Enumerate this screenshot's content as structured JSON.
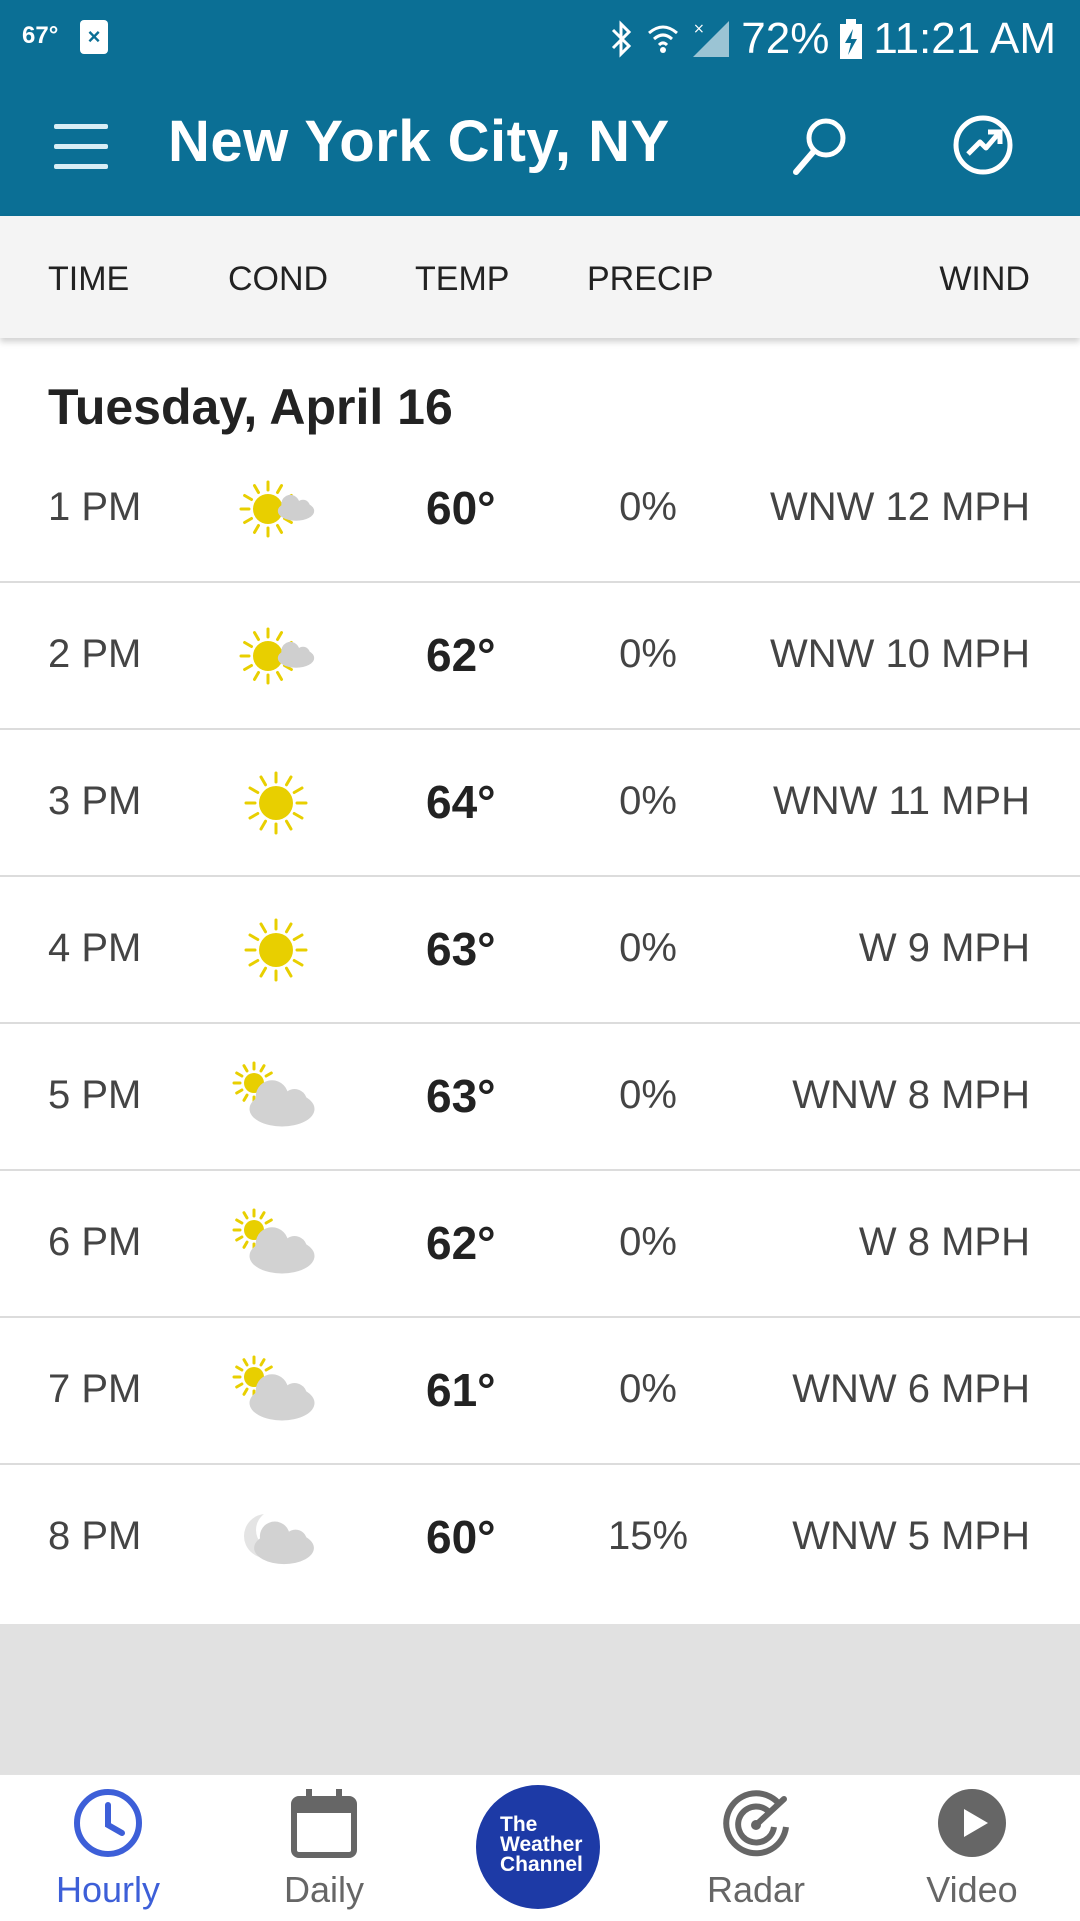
{
  "status_bar": {
    "temp": "67°",
    "notification": "×",
    "battery": "72%",
    "time": "11:21 AM"
  },
  "app_bar": {
    "title": "New York City, NY"
  },
  "columns": {
    "time": "TIME",
    "cond": "COND",
    "temp": "TEMP",
    "precip": "PRECIP",
    "wind": "WIND"
  },
  "day_label": "Tuesday, April 16",
  "rows": [
    {
      "time": "1 PM",
      "icon": "mostly-sunny-icon",
      "temp": "60°",
      "precip": "0%",
      "wind": "WNW 12 MPH"
    },
    {
      "time": "2 PM",
      "icon": "mostly-sunny-icon",
      "temp": "62°",
      "precip": "0%",
      "wind": "WNW 10 MPH"
    },
    {
      "time": "3 PM",
      "icon": "sunny-icon",
      "temp": "64°",
      "precip": "0%",
      "wind": "WNW 11 MPH"
    },
    {
      "time": "4 PM",
      "icon": "sunny-icon",
      "temp": "63°",
      "precip": "0%",
      "wind": "W 9 MPH"
    },
    {
      "time": "5 PM",
      "icon": "partly-cloudy-icon",
      "temp": "63°",
      "precip": "0%",
      "wind": "WNW 8 MPH"
    },
    {
      "time": "6 PM",
      "icon": "partly-cloudy-icon",
      "temp": "62°",
      "precip": "0%",
      "wind": "W 8 MPH"
    },
    {
      "time": "7 PM",
      "icon": "partly-cloudy-icon",
      "temp": "61°",
      "precip": "0%",
      "wind": "WNW 6 MPH"
    },
    {
      "time": "8 PM",
      "icon": "partly-cloudy-night-icon",
      "temp": "60°",
      "precip": "15%",
      "wind": "WNW 5 MPH"
    }
  ],
  "nav": {
    "hourly": "Hourly",
    "daily": "Daily",
    "logo_line1": "The",
    "logo_line2": "Weather",
    "logo_line3": "Channel",
    "radar": "Radar",
    "video": "Video"
  },
  "colors": {
    "brand_bar": "#0b6f95",
    "active_tab": "#3d5fd8",
    "logo": "#1d3aa6",
    "sun": "#e8cf00"
  }
}
